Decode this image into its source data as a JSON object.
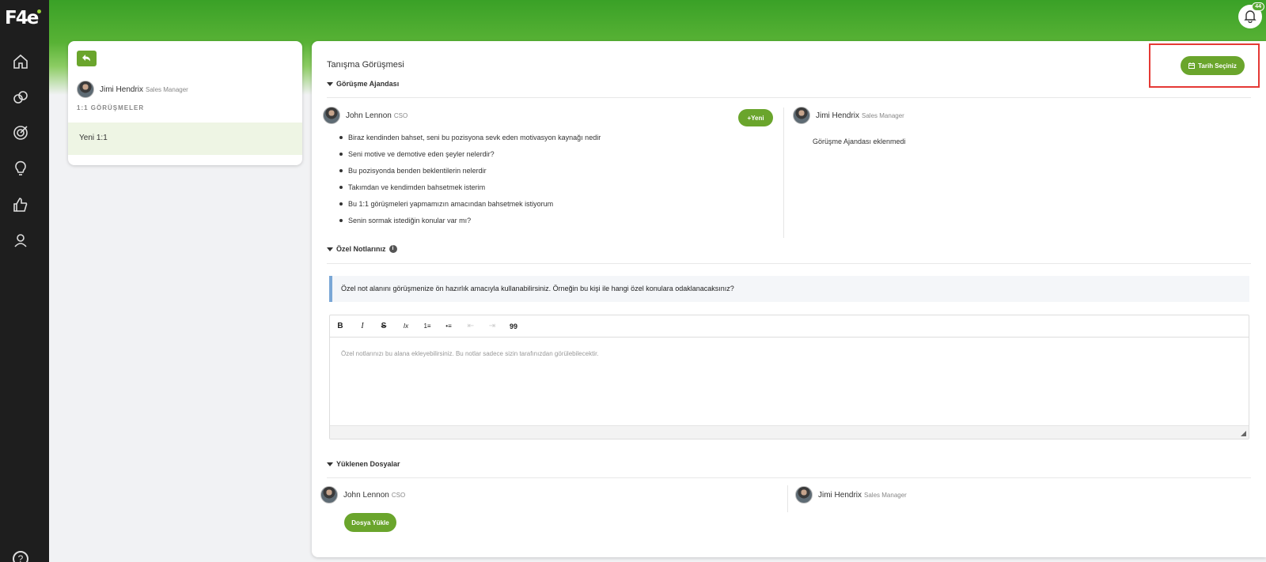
{
  "brand": {
    "logo_text": "F4e",
    "accent": "#6aa52c"
  },
  "header": {
    "notification_count": "44"
  },
  "sidebar": {
    "items": [
      {
        "icon": "home-icon"
      },
      {
        "icon": "links-icon"
      },
      {
        "icon": "target-icon"
      },
      {
        "icon": "lightbulb-icon"
      },
      {
        "icon": "thumbs-up-icon"
      },
      {
        "icon": "people-icon"
      }
    ],
    "help_label": "?"
  },
  "left_panel": {
    "user": {
      "name": "Jimi Hendrix",
      "role": "Sales Manager"
    },
    "section_label": "1:1 GÖRÜŞMELER",
    "items": [
      {
        "label": "Yeni 1:1"
      }
    ]
  },
  "main": {
    "title": "Tanışma Görüşmesi",
    "date_button": "Tarih Seçiniz",
    "agenda": {
      "title": "Görüşme Ajandası",
      "left_user": {
        "name": "John Lennon",
        "role": "CSO"
      },
      "new_button": "+Yeni",
      "items": [
        "Biraz kendinden bahset, seni bu pozisyona sevk eden motivasyon kaynağı nedir",
        "Seni motive ve demotive eden şeyler nelerdir?",
        "Bu pozisyonda benden beklentilerin nelerdir",
        "Takımdan ve kendimden bahsetmek isterim",
        "Bu 1:1 görüşmeleri yapmamızın amacından bahsetmek istiyorum",
        "Senin sormak istediğin konular var mı?"
      ],
      "right_user": {
        "name": "Jimi Hendrix",
        "role": "Sales Manager"
      },
      "empty_text": "Görüşme Ajandası eklenmedi"
    },
    "notes": {
      "title": "Özel Notlarınız",
      "info": "i",
      "hint": "Özel not alanını görüşmenize ön hazırlık amacıyla kullanabilirsiniz. Örneğin bu kişi ile hangi özel konulara odaklanacaksınız?",
      "placeholder": "Özel notlarınızı bu alana ekleyebilirsiniz. Bu notlar sadece sizin tarafınızdan görülebilecektir.",
      "toolbar": [
        {
          "icon": "bold-icon",
          "label": "B"
        },
        {
          "icon": "italic-icon",
          "label": "I"
        },
        {
          "icon": "strikethrough-icon",
          "label": "S"
        },
        {
          "icon": "remove-format-icon",
          "label": "Ix"
        },
        {
          "icon": "numbered-list-icon",
          "label": "1≡"
        },
        {
          "icon": "bulleted-list-icon",
          "label": "•≡"
        },
        {
          "icon": "outdent-icon",
          "label": "⇤"
        },
        {
          "icon": "indent-icon",
          "label": "⇥"
        },
        {
          "icon": "blockquote-icon",
          "label": "99"
        }
      ]
    },
    "files": {
      "title": "Yüklenen Dosyalar",
      "left_user": {
        "name": "John Lennon",
        "role": "CSO"
      },
      "right_user": {
        "name": "Jimi Hendrix",
        "role": "Sales Manager"
      },
      "upload_button": "Dosya Yükle"
    }
  }
}
